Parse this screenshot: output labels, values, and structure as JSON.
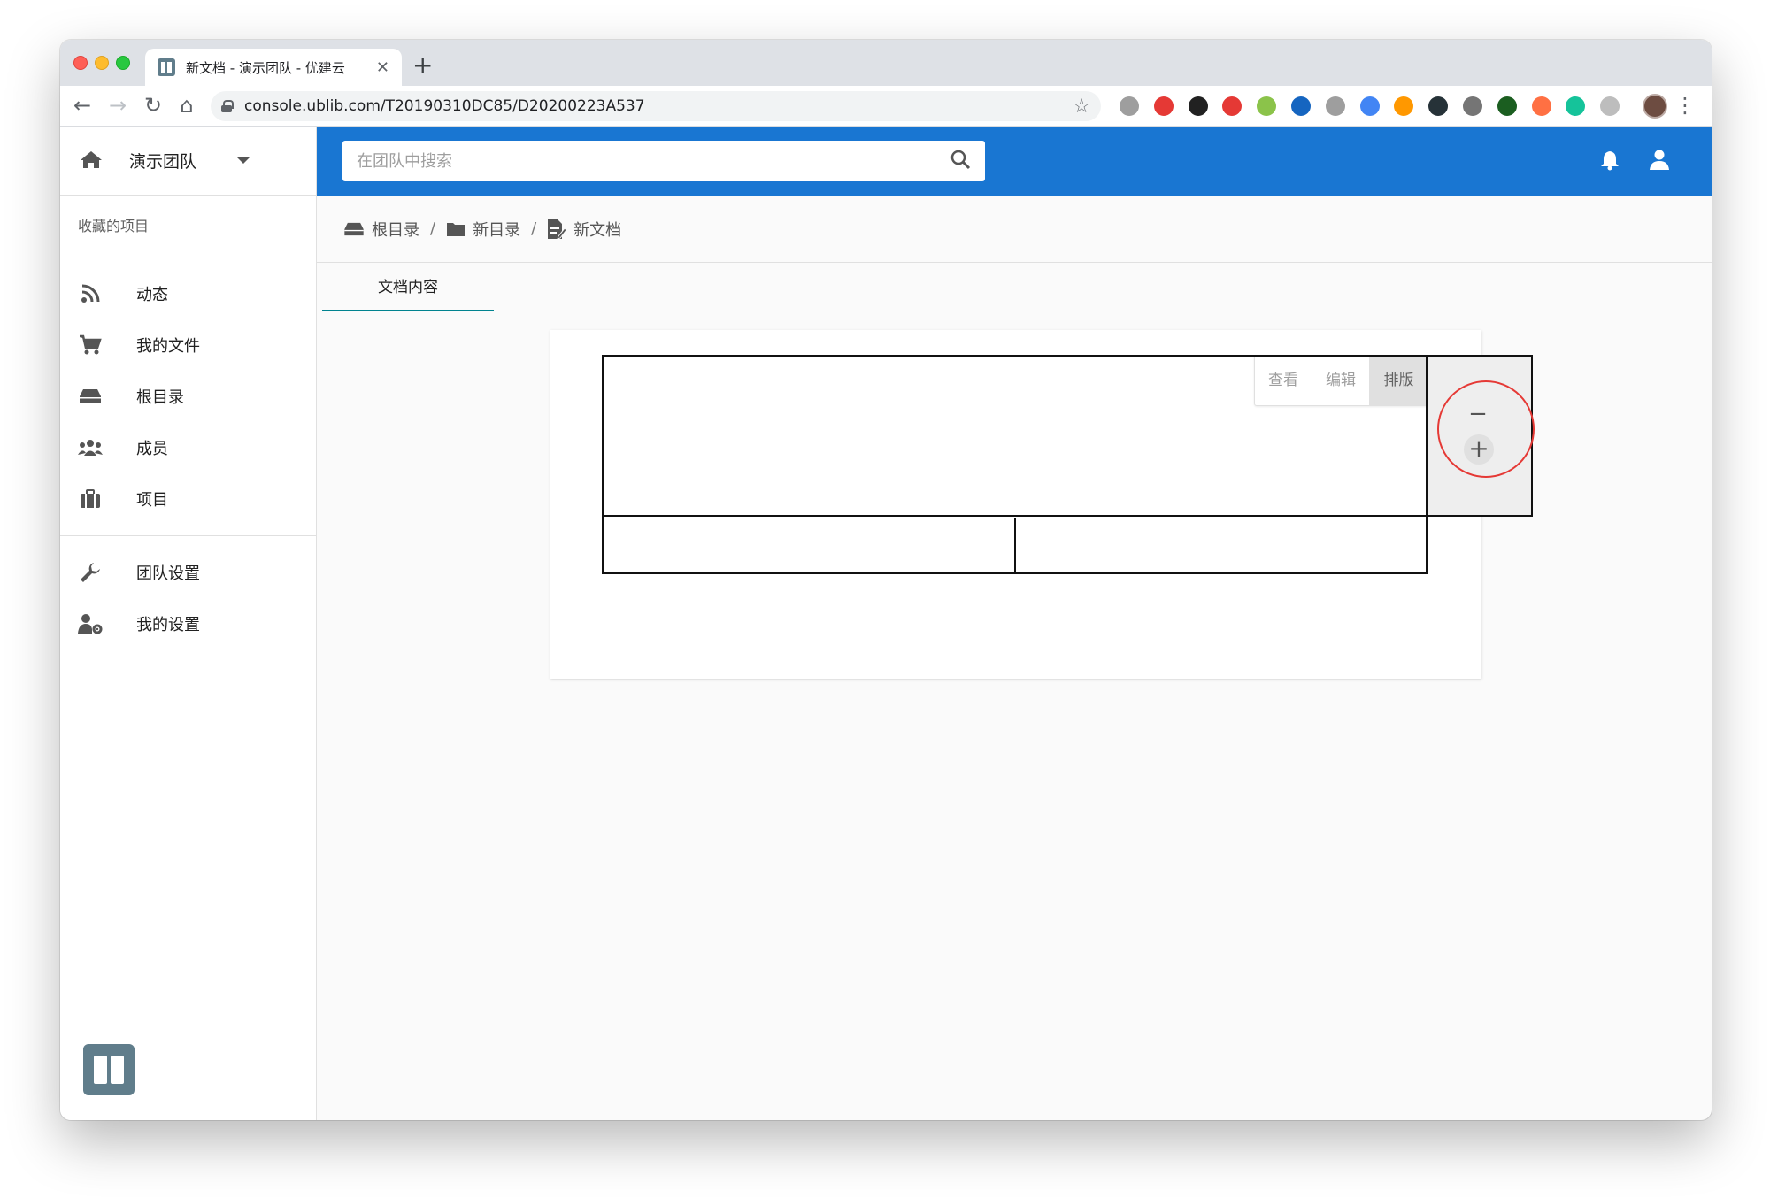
{
  "browser": {
    "tab_title": "新文档 - 演示团队 - 优建云",
    "close_glyph": "✕",
    "new_tab_glyph": "+",
    "url": "console.ublib.com/T20190310DC85/D20200223A537",
    "back_glyph": "←",
    "forward_glyph": "→",
    "reload_glyph": "↻",
    "home_glyph": "⌂",
    "star_glyph": "☆",
    "menu_glyph": "⋮",
    "extension_colors": [
      "#9e9e9e",
      "#e53935",
      "#212121",
      "#e53935",
      "#8bc34a",
      "#1565c0",
      "#9e9e9e",
      "#4285f4",
      "#ff9800",
      "#263238",
      "#757575",
      "#1b5e20",
      "#ff7043",
      "#15c39a",
      "#bdbdbd"
    ]
  },
  "sidebar": {
    "team_name": "演示团队",
    "favorites_header": "收藏的项目",
    "items": [
      {
        "label": "动态",
        "icon": "rss-icon"
      },
      {
        "label": "我的文件",
        "icon": "cart-icon"
      },
      {
        "label": "根目录",
        "icon": "drive-icon"
      },
      {
        "label": "成员",
        "icon": "users-icon"
      },
      {
        "label": "项目",
        "icon": "briefcase-icon"
      }
    ],
    "settings": [
      {
        "label": "团队设置",
        "icon": "wrench-icon"
      },
      {
        "label": "我的设置",
        "icon": "user-cog-icon"
      }
    ]
  },
  "topbar": {
    "search_placeholder": "在团队中搜索",
    "accent": "#1976d2"
  },
  "breadcrumb": [
    {
      "label": "根目录",
      "icon": "drive-icon"
    },
    {
      "label": "新目录",
      "icon": "folder-icon"
    },
    {
      "label": "新文档",
      "icon": "document-edit-icon"
    }
  ],
  "breadcrumb_separator": "/",
  "tabs": [
    {
      "label": "文档内容"
    }
  ],
  "modes": [
    {
      "label": "查看",
      "active": false
    },
    {
      "label": "编辑",
      "active": false
    },
    {
      "label": "排版",
      "active": true
    }
  ],
  "row_controls": {
    "minus": "−",
    "plus": "+"
  }
}
